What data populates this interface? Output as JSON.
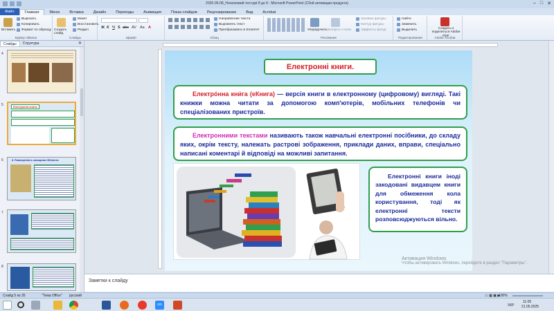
{
  "window": {
    "title": "2025-05-08_Hочатковий тест.ppt 8 до 9 - Microsoft PowerPoint (Сбой активации продукта)",
    "controls": [
      "–",
      "□",
      "✕"
    ]
  },
  "ribbon_tabs": [
    "Файл",
    "Главная",
    "Меню",
    "Вставка",
    "Дизайн",
    "Переходы",
    "Анимация",
    "Показ слайдов",
    "Рецензирование",
    "Вид",
    "Acrobat"
  ],
  "ribbon": {
    "clipboard": {
      "paste": "Вставить",
      "cut": "Вырезать",
      "copy": "Копировать",
      "format_painter": "Формат по образцу",
      "label": "Буфер обмена"
    },
    "slides": {
      "new_slide": "Создать слайд",
      "layout": "Макет",
      "reset": "Восстановить",
      "section": "Раздел",
      "label": "Слайды"
    },
    "font": {
      "label": "Шрифт",
      "format_letters": [
        "Ж",
        "К",
        "Ч",
        "S",
        "abc",
        "AV",
        "Aa",
        "A"
      ]
    },
    "paragraph": {
      "text_direction": "Направление текста",
      "align_text": "Выровнять текст",
      "smartart": "Преобразовать в SmartArt",
      "label": "Абзац"
    },
    "drawing": {
      "arrange": "Упорядочить",
      "quick_styles": "Экспресс-стили",
      "shape_fill": "Заливка фигуры",
      "shape_outline": "Контур фигуры",
      "shape_effects": "Эффекты фигур",
      "label": "Рисование"
    },
    "editing": {
      "find": "Найти",
      "replace": "Заменить",
      "select": "Выделить",
      "label": "Редактирование"
    },
    "adobe": {
      "create_pdf": "Создать и поделиться Adobe PDF",
      "label": "Adobe Acrobat"
    }
  },
  "left_panel": {
    "tabs": [
      "Слайды",
      "Структура"
    ],
    "close": "✕",
    "thumbnails": [
      {
        "num": "4",
        "selected": false
      },
      {
        "num": "5",
        "selected": true,
        "title": "Електронні книги."
      },
      {
        "num": "6",
        "selected": false,
        "title": "8. Повноцінність захищених бібліотек"
      },
      {
        "num": "7",
        "selected": false
      },
      {
        "num": "8",
        "selected": false
      }
    ]
  },
  "slide": {
    "title": "Електронні книги.",
    "box1_term": "Електро́нна кни́га (еКнига)",
    "box1_text": " — версія книги в електронному (цифровому) вигляді. Такі книжки можна читати за допомогою комп'ютерів, мобільних телефонів чи спеціалізованих пристроїв.",
    "box2_term": "Електронними текстами",
    "box2_text": " називають також навчальні електронні посібники, до складу яких, окрім тексту, належать растрові зображення, приклади даних, вправи, спеціально написані коментарі й відповіді на можливі запитання.",
    "box3_text": "Електронні книги іноді закодовані видавцем книги для обмеження кола користування, тоді як електронні тексти розповсюджуються вільно."
  },
  "notes": {
    "placeholder": "Заметки к слайду"
  },
  "activation": {
    "line1": "Активация Windows",
    "line2": "Чтобы активировать Windows, перейдите в раздел \"Параметры\"."
  },
  "status": {
    "slide_count": "Слайд 5 из 35",
    "theme": "\"Тема Office\"",
    "language": "русский",
    "zoom": "100%"
  },
  "taskbar": {
    "apps": [
      "windows-icon",
      "search-icon",
      "task-view-icon",
      "explorer-icon",
      "chrome-icon",
      "word-icon",
      "firefox-icon",
      "yandex-icon",
      "zoom-icon",
      "powerpoint-icon"
    ],
    "zoom_label": "zm",
    "lang": "УКР",
    "time": "11:05",
    "date": "21.05.2025"
  },
  "colors": {
    "accent_red": "#d4202a",
    "accent_blue": "#1a2a9c",
    "accent_magenta": "#d02ab8",
    "border_green": "#2e9e4a"
  }
}
